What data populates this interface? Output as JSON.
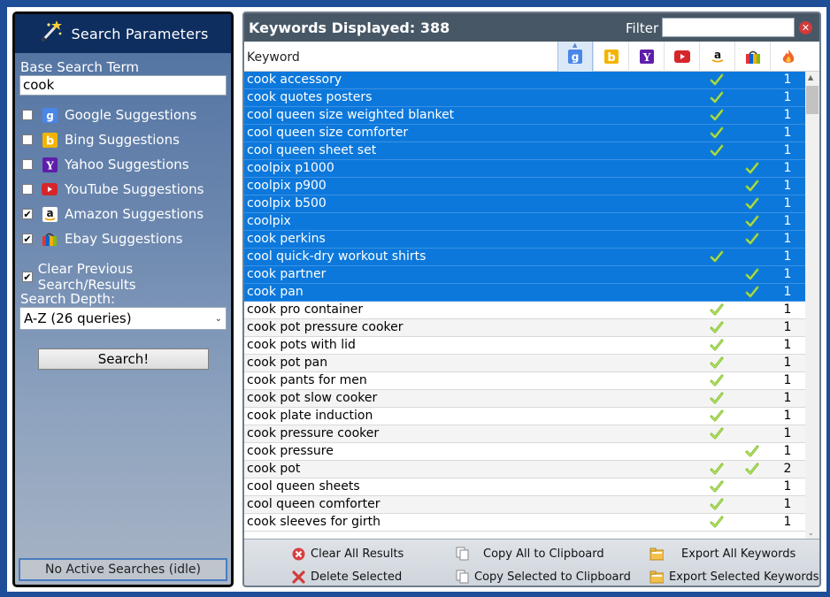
{
  "left": {
    "title": "Search Parameters",
    "base_label": "Base Search Term",
    "base_value": "cook",
    "options": [
      {
        "label": "Google Suggestions",
        "checked": false,
        "icon": "google-icon"
      },
      {
        "label": "Bing Suggestions",
        "checked": false,
        "icon": "bing-icon"
      },
      {
        "label": "Yahoo Suggestions",
        "checked": false,
        "icon": "yahoo-icon"
      },
      {
        "label": "YouTube Suggestions",
        "checked": false,
        "icon": "youtube-icon"
      },
      {
        "label": "Amazon Suggestions",
        "checked": true,
        "icon": "amazon-icon"
      },
      {
        "label": "Ebay Suggestions",
        "checked": true,
        "icon": "ebay-icon"
      }
    ],
    "clear_label": "Clear Previous Search/Results",
    "clear_checked": true,
    "depth_label": "Search Depth:",
    "depth_value": "A-Z (26 queries)",
    "search_button": "Search!",
    "status": "No Active Searches (idle)"
  },
  "right": {
    "count_label": "Keywords Displayed: 388",
    "filter_label": "Filter",
    "filter_value": "",
    "keyword_header": "Keyword",
    "source_columns": [
      "google-icon",
      "bing-icon",
      "yahoo-icon",
      "youtube-icon",
      "amazon-icon",
      "ebay-icon",
      "popularity-flame-icon"
    ],
    "rows": [
      {
        "keyword": "cook accessory",
        "amazon": true,
        "ebay": false,
        "count": "1",
        "selected": true
      },
      {
        "keyword": "cook quotes posters",
        "amazon": true,
        "ebay": false,
        "count": "1",
        "selected": true
      },
      {
        "keyword": "cool queen size weighted blanket",
        "amazon": true,
        "ebay": false,
        "count": "1",
        "selected": true
      },
      {
        "keyword": "cool queen size comforter",
        "amazon": true,
        "ebay": false,
        "count": "1",
        "selected": true
      },
      {
        "keyword": "cool queen sheet set",
        "amazon": true,
        "ebay": false,
        "count": "1",
        "selected": true
      },
      {
        "keyword": "coolpix p1000",
        "amazon": false,
        "ebay": true,
        "count": "1",
        "selected": true
      },
      {
        "keyword": "coolpix p900",
        "amazon": false,
        "ebay": true,
        "count": "1",
        "selected": true
      },
      {
        "keyword": "coolpix b500",
        "amazon": false,
        "ebay": true,
        "count": "1",
        "selected": true
      },
      {
        "keyword": "coolpix",
        "amazon": false,
        "ebay": true,
        "count": "1",
        "selected": true
      },
      {
        "keyword": "cook perkins",
        "amazon": false,
        "ebay": true,
        "count": "1",
        "selected": true
      },
      {
        "keyword": "cool quick-dry workout shirts",
        "amazon": true,
        "ebay": false,
        "count": "1",
        "selected": true
      },
      {
        "keyword": "cook partner",
        "amazon": false,
        "ebay": true,
        "count": "1",
        "selected": true
      },
      {
        "keyword": "cook pan",
        "amazon": false,
        "ebay": true,
        "count": "1",
        "selected": true
      },
      {
        "keyword": "cook pro container",
        "amazon": true,
        "ebay": false,
        "count": "1",
        "selected": false
      },
      {
        "keyword": "cook pot pressure cooker",
        "amazon": true,
        "ebay": false,
        "count": "1",
        "selected": false
      },
      {
        "keyword": "cook pots with lid",
        "amazon": true,
        "ebay": false,
        "count": "1",
        "selected": false
      },
      {
        "keyword": "cook pot pan",
        "amazon": true,
        "ebay": false,
        "count": "1",
        "selected": false
      },
      {
        "keyword": "cook pants for men",
        "amazon": true,
        "ebay": false,
        "count": "1",
        "selected": false
      },
      {
        "keyword": "cook pot slow cooker",
        "amazon": true,
        "ebay": false,
        "count": "1",
        "selected": false
      },
      {
        "keyword": "cook plate induction",
        "amazon": true,
        "ebay": false,
        "count": "1",
        "selected": false
      },
      {
        "keyword": "cook pressure cooker",
        "amazon": true,
        "ebay": false,
        "count": "1",
        "selected": false
      },
      {
        "keyword": "cook pressure",
        "amazon": false,
        "ebay": true,
        "count": "1",
        "selected": false
      },
      {
        "keyword": "cook pot",
        "amazon": true,
        "ebay": true,
        "count": "2",
        "selected": false
      },
      {
        "keyword": "cool queen sheets",
        "amazon": true,
        "ebay": false,
        "count": "1",
        "selected": false
      },
      {
        "keyword": "cool queen comforter",
        "amazon": true,
        "ebay": false,
        "count": "1",
        "selected": false
      },
      {
        "keyword": "cook sleeves for girth",
        "amazon": true,
        "ebay": false,
        "count": "1",
        "selected": false
      }
    ],
    "footer": {
      "clear_all": "Clear All Results",
      "delete_selected": "Delete Selected",
      "copy_all": "Copy All to Clipboard",
      "copy_selected": "Copy Selected to Clipboard",
      "export_all": "Export All Keywords",
      "export_selected": "Export Selected Keywords"
    }
  }
}
